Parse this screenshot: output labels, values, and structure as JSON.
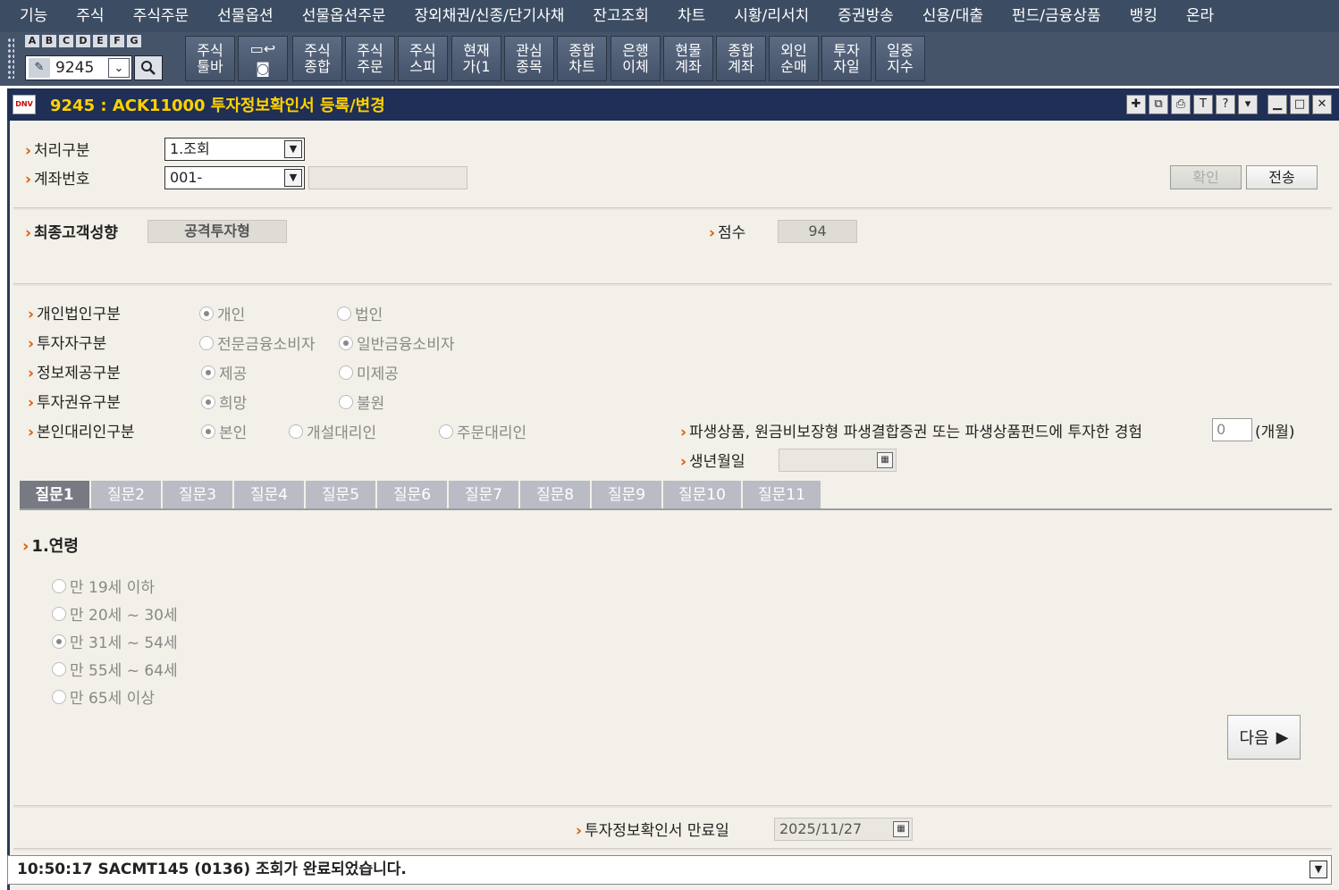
{
  "menu": [
    "기능",
    "주식",
    "주식주문",
    "선물옵션",
    "선물옵션주문",
    "장외채권/신종/단기사채",
    "잔고조회",
    "차트",
    "시황/리서치",
    "증권방송",
    "신용/대출",
    "펀드/금융상품",
    "뱅킹",
    "온라"
  ],
  "toolbar": {
    "abc": [
      "A",
      "B",
      "C",
      "D",
      "E",
      "F",
      "G"
    ],
    "screen_no": "9245",
    "buttons": [
      "주식툴바",
      "주식종합",
      "주식주문",
      "주식스피",
      "현재가(1",
      "관심종목",
      "종합차트",
      "은행이체",
      "현물계좌",
      "종합계좌",
      "외인순매",
      "투자자일",
      "일중지수"
    ]
  },
  "window": {
    "logo": "DNV",
    "title": "9245 : ACK11000 투자정보확인서 등록/변경",
    "icons": [
      "pin-icon",
      "link-icon",
      "print-icon",
      "text-icon",
      "help-icon",
      "dropdown-icon",
      "minimize-icon",
      "maximize-icon",
      "close-icon"
    ]
  },
  "form": {
    "process_label": "처리구분",
    "process_value": "1.조회",
    "account_label": "계좌번호",
    "account_value": "001-",
    "account_name": "",
    "confirm_btn": "확인",
    "send_btn": "전송",
    "final_label": "최종고객성향",
    "final_value": "공격투자형",
    "score_label": "점수",
    "score_value": "94"
  },
  "rows": [
    {
      "label": "개인법인구분",
      "options": [
        "개인",
        "법인"
      ],
      "selected": 0
    },
    {
      "label": "투자자구분",
      "options": [
        "전문금융소비자",
        "일반금융소비자"
      ],
      "selected": 1
    },
    {
      "label": "정보제공구분",
      "options": [
        "제공",
        "미제공"
      ],
      "selected": 0
    },
    {
      "label": "투자권유구분",
      "options": [
        "희망",
        "불원"
      ],
      "selected": 0
    },
    {
      "label": "본인대리인구분",
      "options": [
        "본인",
        "개설대리인",
        "주문대리인"
      ],
      "selected": 0
    }
  ],
  "deriv": {
    "label": "파생상품, 원금비보장형 파생결합증권 또는 파생상품펀드에 투자한 경험",
    "months": "0",
    "unit": "(개월)",
    "birth_label": "생년월일",
    "birth_value": ""
  },
  "tabs": [
    "질문1",
    "질문2",
    "질문3",
    "질문4",
    "질문5",
    "질문6",
    "질문7",
    "질문8",
    "질문9",
    "질문10",
    "질문11"
  ],
  "question": {
    "title": "1.연령",
    "options": [
      "만 19세 이하",
      "만 20세 ~ 30세",
      "만 31세 ~ 54세",
      "만 55세 ~ 64세",
      "만 65세 이상"
    ],
    "selected": 2
  },
  "next_btn": "다음",
  "expiry": {
    "label": "투자정보확인서 만료일",
    "value": "2025/11/27"
  },
  "status": "10:50:17 SACMT145 (0136) 조회가 완료되었습니다."
}
